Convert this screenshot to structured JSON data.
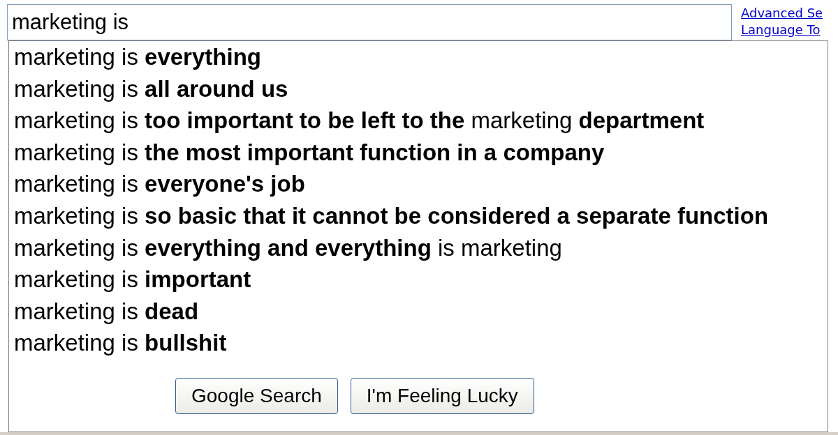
{
  "search": {
    "value": "marketing is "
  },
  "links": [
    "Advanced Se",
    "Language To"
  ],
  "suggestions": [
    "marketing is **everything**",
    "marketing is **all around us**",
    "marketing is **too important to be left to the** marketing **department**",
    "marketing is **the most important function in a company**",
    "marketing is **everyone's job**",
    "marketing is **so basic that it cannot be considered a separate function**",
    "marketing is **everything and everything** is marketing",
    "marketing is **important**",
    "marketing is **dead**",
    "marketing is **bullshit**"
  ],
  "buttons": [
    "Google Search",
    "I'm Feeling Lucky"
  ]
}
